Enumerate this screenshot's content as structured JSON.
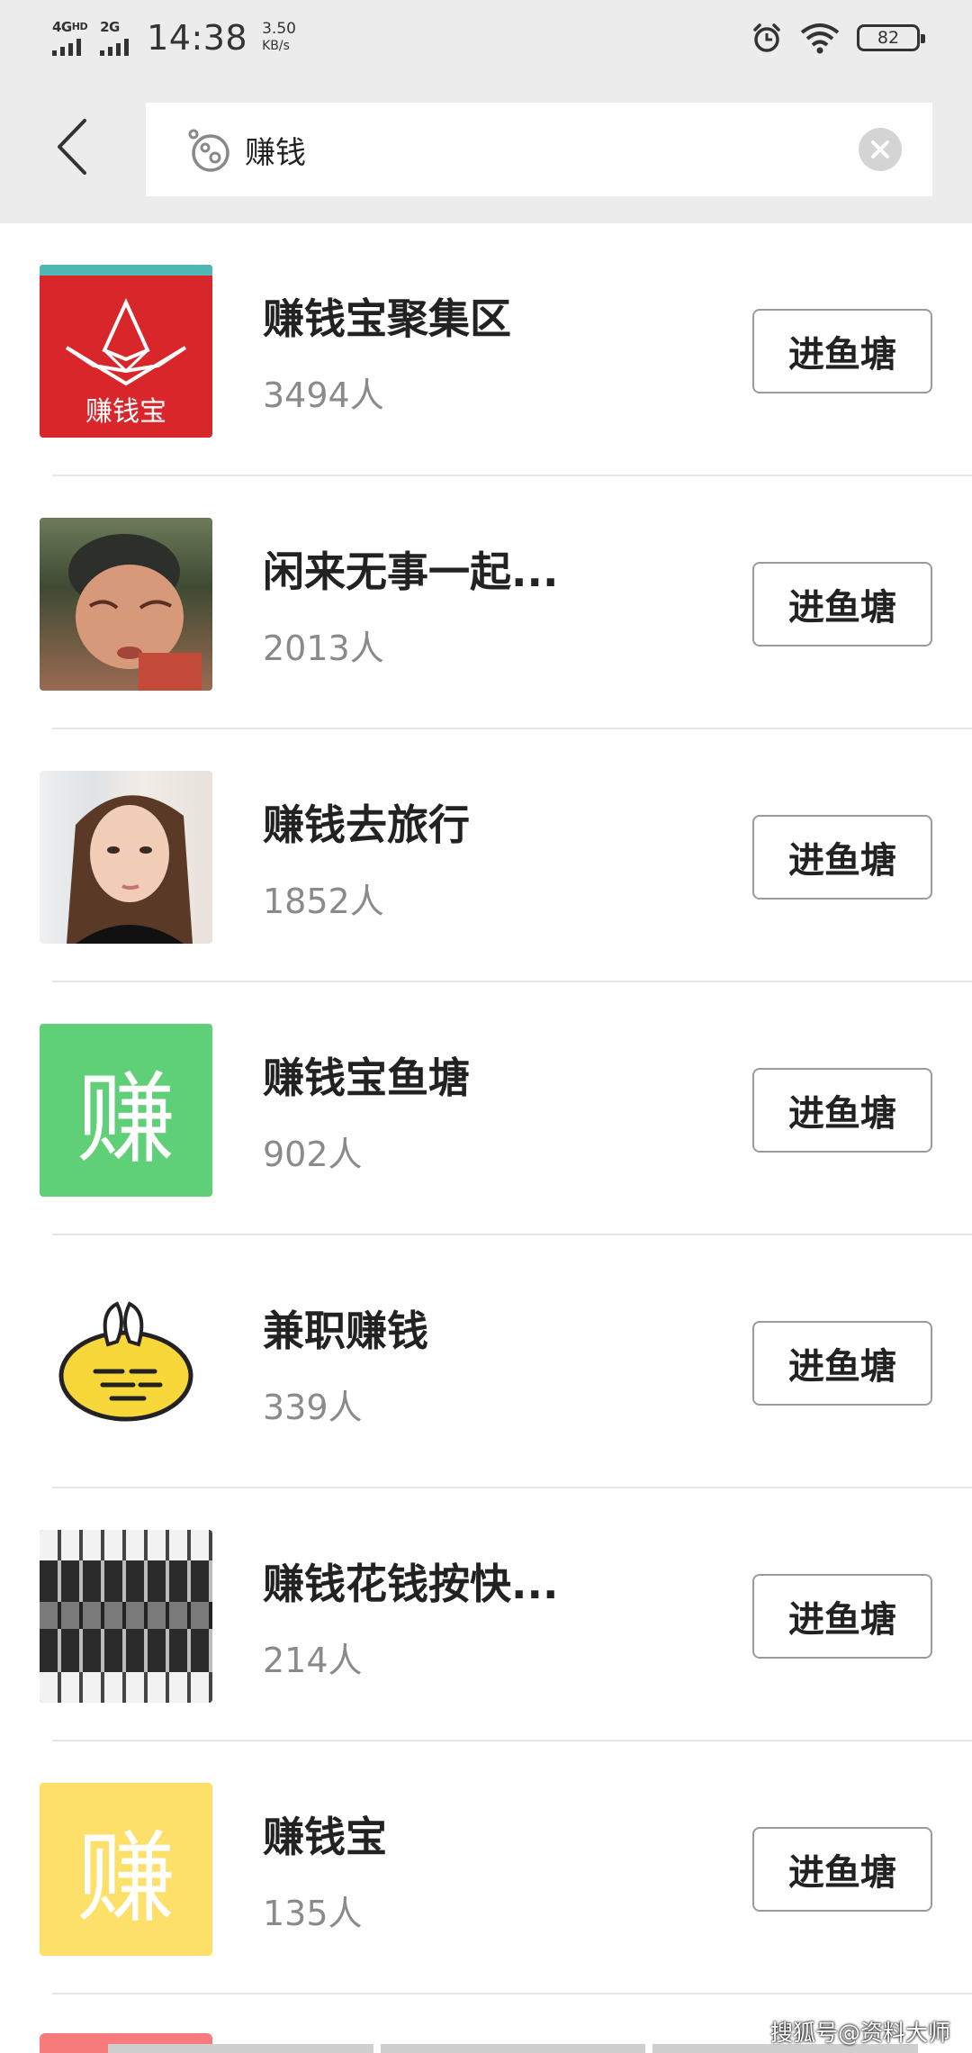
{
  "status_bar": {
    "network1": "4G",
    "network1_sup": "HD",
    "network2": "2G",
    "time": "14:38",
    "speed_value": "3.50",
    "speed_unit": "KB/s",
    "battery": "82"
  },
  "search": {
    "query": "赚钱"
  },
  "groups": [
    {
      "name": "赚钱宝聚集区",
      "count": "3494人",
      "button": "进鱼塘"
    },
    {
      "name": "闲来无事一起...",
      "count": "2013人",
      "button": "进鱼塘"
    },
    {
      "name": "赚钱去旅行",
      "count": "1852人",
      "button": "进鱼塘"
    },
    {
      "name": "赚钱宝鱼塘",
      "count": "902人",
      "button": "进鱼塘",
      "thumb_char": "赚"
    },
    {
      "name": "兼职赚钱",
      "count": "339人",
      "button": "进鱼塘"
    },
    {
      "name": "赚钱花钱按快...",
      "count": "214人",
      "button": "进鱼塘"
    },
    {
      "name": "赚钱宝",
      "count": "135人",
      "button": "进鱼塘",
      "thumb_char": "赚"
    }
  ],
  "thumb1_text": "赚钱宝",
  "watermark": "搜狐号@资料大师",
  "colors": {
    "header_bg": "#ececec",
    "thumb_red": "#d8262b",
    "thumb_green": "#5fcf78",
    "thumb_yellow": "#fde06a",
    "partial_pink": "#f77b7b"
  }
}
